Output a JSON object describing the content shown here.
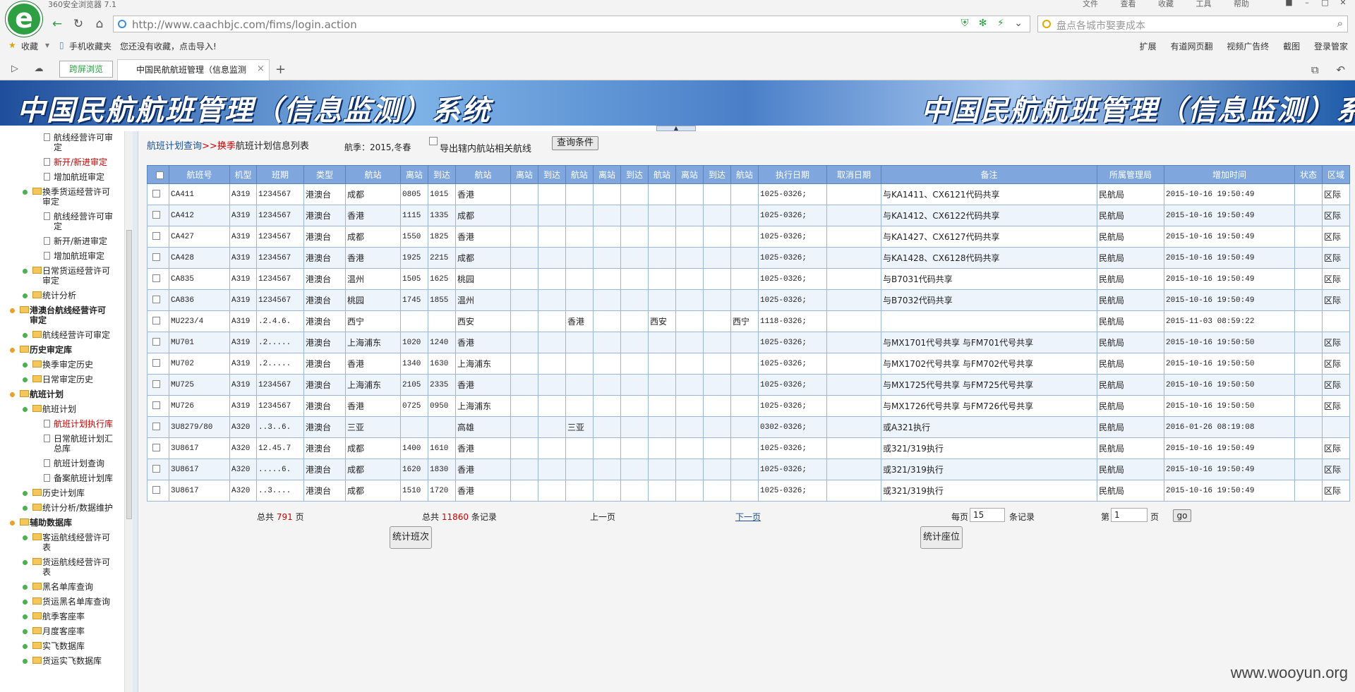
{
  "browser": {
    "app_title": "360安全浏览器 7.1",
    "menus": [
      "文件",
      "查看",
      "收藏",
      "工具",
      "帮助"
    ],
    "url": "http://www.caachbjc.com/fims/login.action",
    "search_placeholder": "盘点各城市娶妻成本",
    "bookmarks": {
      "favorites": "收藏",
      "mobile": "手机收藏夹",
      "hint": "您还没有收藏，点击导入!",
      "right": [
        "扩展",
        "有道网页翻",
        "视频广告终",
        "截图",
        "登录管家"
      ]
    },
    "split_view": "跨屏浏览",
    "tab_title": "中国民航航班管理（信息监测"
  },
  "banner": {
    "title": "中国民航航班管理（信息监测）系统"
  },
  "sidebar": {
    "items": [
      {
        "label": "航线经营许可审",
        "label2": "定",
        "level": 3,
        "color": "normal"
      },
      {
        "label": "新开/新进审定",
        "level": 3,
        "color": "red"
      },
      {
        "label": "增加航班审定",
        "level": 3,
        "color": "normal"
      },
      {
        "label": "换季货运经营许可",
        "label2": "审定",
        "level": 2,
        "color": "normal"
      },
      {
        "label": "航线经营许可审",
        "label2": "定",
        "level": 3,
        "color": "normal"
      },
      {
        "label": "新开/新进审定",
        "level": 3,
        "color": "normal"
      },
      {
        "label": "增加航班审定",
        "level": 3,
        "color": "normal"
      },
      {
        "label": "日常货运经营许可",
        "label2": "审定",
        "level": 2,
        "color": "normal"
      },
      {
        "label": "统计分析",
        "level": 2,
        "color": "normal"
      },
      {
        "label": "港澳台航线经营许可",
        "label2": "审定",
        "level": 1,
        "color": "bold"
      },
      {
        "label": "航线经营许可审定",
        "level": 2,
        "color": "normal"
      },
      {
        "label": "历史审定库",
        "level": 1,
        "color": "bold"
      },
      {
        "label": "换季审定历史",
        "level": 2,
        "color": "normal"
      },
      {
        "label": "日常审定历史",
        "level": 2,
        "color": "normal"
      },
      {
        "label": "航班计划",
        "level": 1,
        "color": "bold"
      },
      {
        "label": "航班计划",
        "level": 2,
        "color": "normal"
      },
      {
        "label": "航班计划执行库",
        "level": 3,
        "color": "red"
      },
      {
        "label": "日常航班计划汇",
        "label2": "总库",
        "level": 3,
        "color": "normal"
      },
      {
        "label": "航班计划查询",
        "level": 3,
        "color": "normal"
      },
      {
        "label": "备案航班计划库",
        "level": 3,
        "color": "normal"
      },
      {
        "label": "历史计划库",
        "level": 2,
        "color": "normal"
      },
      {
        "label": "统计分析/数据维护",
        "level": 2,
        "color": "normal"
      },
      {
        "label": "辅助数据库",
        "level": 1,
        "color": "bold"
      },
      {
        "label": "客运航线经营许可",
        "label2": "表",
        "level": 2,
        "color": "normal"
      },
      {
        "label": "货运航线经营许可",
        "label2": "表",
        "level": 2,
        "color": "normal"
      },
      {
        "label": "黑名单库查询",
        "level": 2,
        "color": "normal"
      },
      {
        "label": "货运黑名单库查询",
        "level": 2,
        "color": "normal"
      },
      {
        "label": "航季客座率",
        "level": 2,
        "color": "normal"
      },
      {
        "label": "月度客座率",
        "level": 2,
        "color": "normal"
      },
      {
        "label": "实飞数据库",
        "level": 2,
        "color": "normal"
      },
      {
        "label": "货运实飞数据库",
        "level": 2,
        "color": "normal"
      }
    ]
  },
  "main": {
    "breadcrumb_link": "航班计划查询",
    "breadcrumb_sep": ">>",
    "breadcrumb_red": "换季",
    "breadcrumb_rest": "航班计划信息列表",
    "season": "航季：2015,冬春",
    "export_label": "导出辖内航站相关航线",
    "query_button": "查询条件",
    "columns": [
      "航班号",
      "机型",
      "班期",
      "类型",
      "航站",
      "离站",
      "到达",
      "航站",
      "离站",
      "到达",
      "航站",
      "离站",
      "到达",
      "航站",
      "离站",
      "到达",
      "航站",
      "执行日期",
      "取消日期",
      "备注",
      "所属管理局",
      "增加时间",
      "状态",
      "区域"
    ],
    "rows": [
      [
        "CA411",
        "A319",
        "1234567",
        "港澳台",
        "成都",
        "0805",
        "1015",
        "香港",
        "",
        "",
        "",
        "",
        "",
        "",
        "",
        "",
        "",
        "1025-0326;",
        "",
        "与KA1411、CX6121代码共享",
        "民航局",
        "2015-10-16 19:50:49",
        "",
        "区际"
      ],
      [
        "CA412",
        "A319",
        "1234567",
        "港澳台",
        "香港",
        "1115",
        "1335",
        "成都",
        "",
        "",
        "",
        "",
        "",
        "",
        "",
        "",
        "",
        "1025-0326;",
        "",
        "与KA1412、CX6122代码共享",
        "民航局",
        "2015-10-16 19:50:49",
        "",
        "区际"
      ],
      [
        "CA427",
        "A319",
        "1234567",
        "港澳台",
        "成都",
        "1550",
        "1825",
        "香港",
        "",
        "",
        "",
        "",
        "",
        "",
        "",
        "",
        "",
        "1025-0326;",
        "",
        "与KA1427、CX6127代码共享",
        "民航局",
        "2015-10-16 19:50:49",
        "",
        "区际"
      ],
      [
        "CA428",
        "A319",
        "1234567",
        "港澳台",
        "香港",
        "1925",
        "2215",
        "成都",
        "",
        "",
        "",
        "",
        "",
        "",
        "",
        "",
        "",
        "1025-0326;",
        "",
        "与KA1428、CX6128代码共享",
        "民航局",
        "2015-10-16 19:50:49",
        "",
        "区际"
      ],
      [
        "CA835",
        "A319",
        "1234567",
        "港澳台",
        "温州",
        "1505",
        "1625",
        "桃园",
        "",
        "",
        "",
        "",
        "",
        "",
        "",
        "",
        "",
        "1025-0326;",
        "",
        "与B7031代码共享",
        "民航局",
        "2015-10-16 19:50:49",
        "",
        "区际"
      ],
      [
        "CA836",
        "A319",
        "1234567",
        "港澳台",
        "桃园",
        "1745",
        "1855",
        "温州",
        "",
        "",
        "",
        "",
        "",
        "",
        "",
        "",
        "",
        "1025-0326;",
        "",
        "与B7032代码共享",
        "民航局",
        "2015-10-16 19:50:49",
        "",
        "区际"
      ],
      [
        "MU223/4",
        "A319",
        ".2.4.6.",
        "港澳台",
        "西宁",
        "",
        "",
        "西安",
        "",
        "",
        "香港",
        "",
        "",
        "西安",
        "",
        "",
        "西宁",
        "1118-0326;",
        "",
        "",
        "民航局",
        "2015-11-03 08:59:22",
        "",
        ""
      ],
      [
        "MU701",
        "A319",
        ".2.....",
        "港澳台",
        "上海浦东",
        "1020",
        "1240",
        "香港",
        "",
        "",
        "",
        "",
        "",
        "",
        "",
        "",
        "",
        "1025-0326;",
        "",
        "与MX1701代号共享 与FM701代号共享",
        "民航局",
        "2015-10-16 19:50:50",
        "",
        "区际"
      ],
      [
        "MU702",
        "A319",
        ".2.....",
        "港澳台",
        "香港",
        "1340",
        "1630",
        "上海浦东",
        "",
        "",
        "",
        "",
        "",
        "",
        "",
        "",
        "",
        "1025-0326;",
        "",
        "与MX1702代号共享 与FM702代号共享",
        "民航局",
        "2015-10-16 19:50:50",
        "",
        "区际"
      ],
      [
        "MU725",
        "A319",
        "1234567",
        "港澳台",
        "上海浦东",
        "2105",
        "2335",
        "香港",
        "",
        "",
        "",
        "",
        "",
        "",
        "",
        "",
        "",
        "1025-0326;",
        "",
        "与MX1725代号共享 与FM725代号共享",
        "民航局",
        "2015-10-16 19:50:50",
        "",
        "区际"
      ],
      [
        "MU726",
        "A319",
        "1234567",
        "港澳台",
        "香港",
        "0725",
        "0950",
        "上海浦东",
        "",
        "",
        "",
        "",
        "",
        "",
        "",
        "",
        "",
        "1025-0326;",
        "",
        "与MX1726代号共享 与FM726代号共享",
        "民航局",
        "2015-10-16 19:50:50",
        "",
        "区际"
      ],
      [
        "3U8279/80",
        "A320",
        "..3..6.",
        "港澳台",
        "三亚",
        "",
        "",
        "高雄",
        "",
        "",
        "三亚",
        "",
        "",
        "",
        "",
        "",
        "",
        "0302-0326;",
        "",
        "或A321执行",
        "民航局",
        "2016-01-26 08:19:08",
        "",
        ""
      ],
      [
        "3U8617",
        "A320",
        "12.45.7",
        "港澳台",
        "成都",
        "1400",
        "1610",
        "香港",
        "",
        "",
        "",
        "",
        "",
        "",
        "",
        "",
        "",
        "1025-0326;",
        "",
        "或321/319执行",
        "民航局",
        "2015-10-16 19:50:49",
        "",
        "区际"
      ],
      [
        "3U8617",
        "A320",
        ".....6.",
        "港澳台",
        "成都",
        "1620",
        "1830",
        "香港",
        "",
        "",
        "",
        "",
        "",
        "",
        "",
        "",
        "",
        "1025-0326;",
        "",
        "或321/319执行",
        "民航局",
        "2015-10-16 19:50:49",
        "",
        "区际"
      ],
      [
        "3U8617",
        "A320",
        "..3....",
        "港澳台",
        "成都",
        "1510",
        "1720",
        "香港",
        "",
        "",
        "",
        "",
        "",
        "",
        "",
        "",
        "",
        "1025-0326;",
        "",
        "或321/319执行",
        "民航局",
        "2015-10-16 19:50:49",
        "",
        "区际"
      ]
    ],
    "pager": {
      "total_pages_prefix": "总共",
      "total_pages": "791",
      "total_pages_suffix": "页",
      "total_records_prefix": "总共",
      "total_records": "11860",
      "total_records_suffix": "条记录",
      "prev": "上一页",
      "next": "下一页",
      "per_page_prefix": "每页",
      "per_page": "15",
      "per_page_suffix": "条记录",
      "page_prefix": "第",
      "page": "1",
      "page_suffix": "页",
      "go": "go"
    },
    "stat_flights": "统计班次",
    "stat_seats": "统计座位"
  },
  "watermark": "www.wooyun.org"
}
